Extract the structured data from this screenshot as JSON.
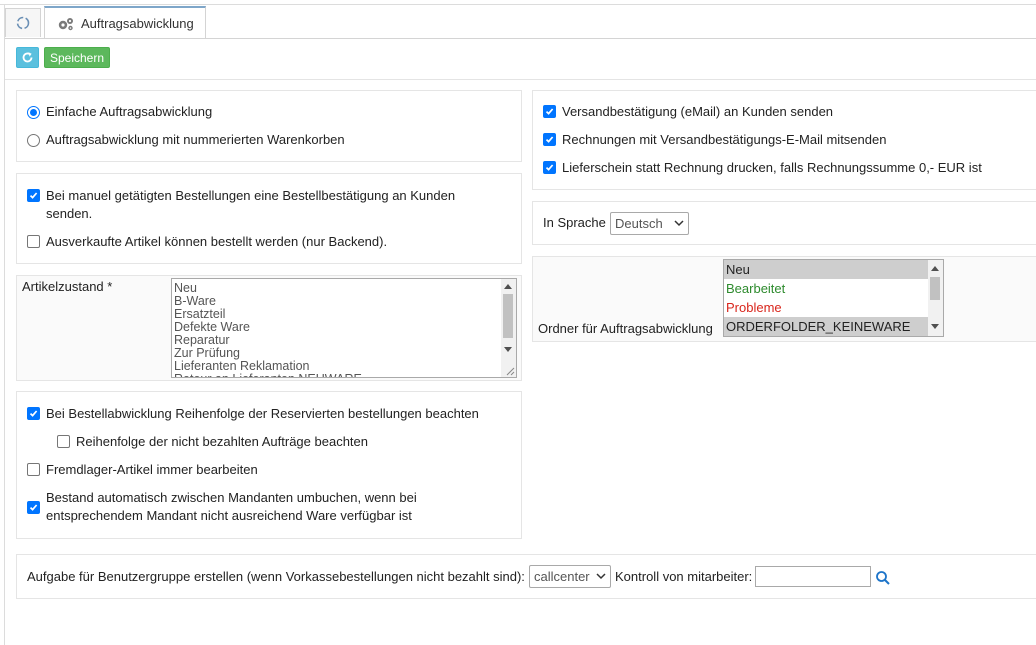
{
  "tabs": {
    "active_label": "Auftragsabwicklung",
    "home_icon": "refresh-circle-icon",
    "active_icon": "gears-icon"
  },
  "toolbar": {
    "refresh_icon": "refresh-icon",
    "save_label": "Speichern"
  },
  "colors": {
    "save_button": "#5cb85c",
    "refresh_button": "#5bc0de",
    "accent": "#0075ff",
    "status_green": "#2e8b2e",
    "status_red": "#d9261c"
  },
  "mode": {
    "option_simple": "Einfache Auftragsabwicklung",
    "option_numbered": "Auftragsabwicklung mit nummerierten Warenkorben",
    "selected": "simple"
  },
  "manual": {
    "confirm_label": "Bei manuel getätigten Bestellungen eine Bestellbestätigung an Kunden senden.",
    "confirm_checked": true,
    "soldout_label": "Ausverkaufte Artikel können bestellt werden (nur Backend).",
    "soldout_checked": false
  },
  "article_state": {
    "label": "Artikelzustand *",
    "options": [
      "Neu",
      "B-Ware",
      "Ersatzteil",
      "Defekte Ware",
      "Reparatur",
      "Zur Prüfung",
      "Lieferanten Reklamation",
      "Retour an Lieferanten NEUWARE"
    ]
  },
  "processing": {
    "reserved_order_label": "Bei Bestellabwicklung Reihenfolge der Reservierten bestellungen beachten",
    "reserved_order_checked": true,
    "unpaid_order_label": "Reihenfolge der nicht bezahlten Aufträge beachten",
    "unpaid_order_checked": false,
    "external_stock_label": "Fremdlager-Artikel immer bearbeiten",
    "external_stock_checked": false,
    "auto_transfer_label": "Bestand automatisch zwischen Mandanten umbuchen, wenn bei entsprechendem Mandant nicht ausreichend Ware verfügbar ist",
    "auto_transfer_checked": true
  },
  "shipping": {
    "email_label": "Versandbestätigung (eMail) an Kunden senden",
    "email_checked": true,
    "invoice_label": "Rechnungen mit Versandbestätigungs-E-Mail mitsenden",
    "invoice_checked": true,
    "delivery_note_label": "Lieferschein statt Rechnung drucken, falls Rechnungssumme 0,- EUR ist",
    "delivery_note_checked": true
  },
  "language": {
    "label": "In Sprache",
    "selected": "Deutsch"
  },
  "folder": {
    "label": "Ordner für Auftragsabwicklung",
    "options": [
      {
        "text": "Neu",
        "color": "#222222",
        "selected": true
      },
      {
        "text": "Bearbeitet",
        "color": "#2e8b2e",
        "selected": false
      },
      {
        "text": "Probleme",
        "color": "#d9261c",
        "selected": false
      },
      {
        "text": "ORDERFOLDER_KEINEWARE",
        "color": "#222222",
        "selected": true
      }
    ]
  },
  "task": {
    "label": "Aufgabe für Benutzergruppe erstellen (wenn Vorkassebestellungen nicht bezahlt sind):",
    "group_selected": "callcenter",
    "control_label": "Kontroll von mitarbeiter:",
    "control_value": "",
    "search_icon": "search-icon"
  }
}
